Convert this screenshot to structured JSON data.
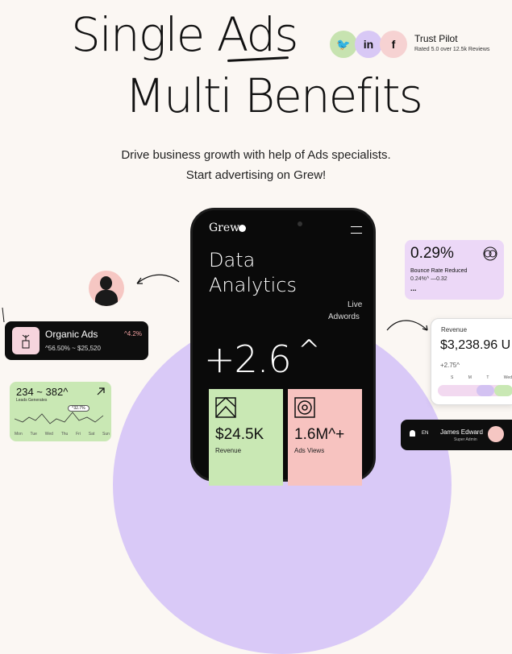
{
  "hero": {
    "line1": "Single Ads",
    "line2": "Multi Benefits",
    "tagline_1": "Drive business growth with help of Ads specialists.",
    "tagline_2": "Start advertising on Grew!"
  },
  "social": {
    "twitter_label": "🐦",
    "linkedin_label": "in",
    "facebook_label": "f",
    "trust_title": "Trust Pilot",
    "trust_sub": "Rated 5.0 over 12.5k Reviews"
  },
  "phone": {
    "brand": "Grew",
    "title_1": "Data",
    "title_2": "Analytics",
    "live_1": "Live",
    "live_2": "Adwords",
    "big_value": "+2.6",
    "big_caret": "^",
    "revenue_value": "$24.5K",
    "revenue_label": "Revenue",
    "views_value": "1.6M^+",
    "views_label": "Ads Views"
  },
  "organic": {
    "title": "Organic Ads",
    "delta": "^4.2%",
    "stats": "^56.50%  ~  $25,520"
  },
  "leads": {
    "value": "234 ~ 382^",
    "label": "Leads Generates",
    "bubble": "^32.7%",
    "days": [
      "Mon",
      "Tue",
      "Wed",
      "Thu",
      "Fri",
      "Sat",
      "Sun"
    ]
  },
  "bounce": {
    "value": "0.29%",
    "label": "Bounce Rate Reduced",
    "sub": "0.24%^  —0.32",
    "more": "..."
  },
  "revenue_card": {
    "label": "Revenue",
    "value": "$3,238.96 U",
    "delta": "+2.75^",
    "days": [
      "S",
      "M",
      "T",
      "Wed"
    ]
  },
  "user": {
    "lang": "EN",
    "name": "James Edward",
    "role": "Super Admin"
  },
  "colors": {
    "twitter_bg": "#c7e3b0",
    "linkedin_bg": "#d8c8f5",
    "facebook_bg": "#f6d2d2",
    "green_card": "#c9e8b4",
    "pink_card": "#f7c3c0",
    "purple": "#d9c9f7"
  }
}
